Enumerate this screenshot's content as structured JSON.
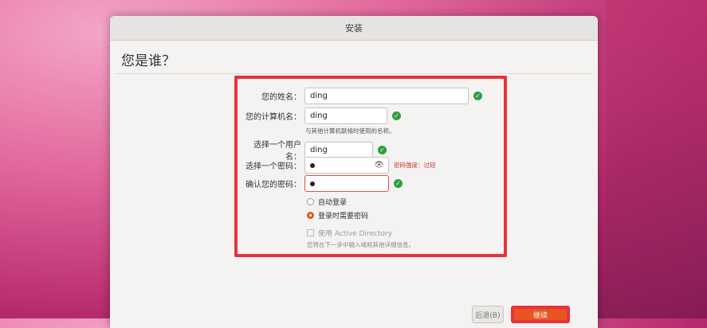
{
  "window": {
    "title": "安装"
  },
  "page_title": "您是谁？",
  "form": {
    "name": {
      "label": "您的姓名：",
      "value": "ding"
    },
    "computer": {
      "label": "您的计算机名：",
      "value": "ding",
      "hint": "与其他计算机联络时使用的名称。"
    },
    "username": {
      "label": "选择一个用户名：",
      "value": "ding"
    },
    "password": {
      "label": "选择一个密码：",
      "strength": "密码强度：过短"
    },
    "confirm": {
      "label": "确认您的密码："
    },
    "auto_login": "自动登录",
    "require_password": "登录时需要密码",
    "active_directory": "使用 Active Directory",
    "ad_hint": "您将在下一步中输入域和其他详细信息。"
  },
  "buttons": {
    "back": "后退(B)",
    "next": "继续"
  },
  "colors": {
    "highlight": "#e8323c",
    "accent": "#e95420",
    "ok": "#2e9f3a"
  }
}
